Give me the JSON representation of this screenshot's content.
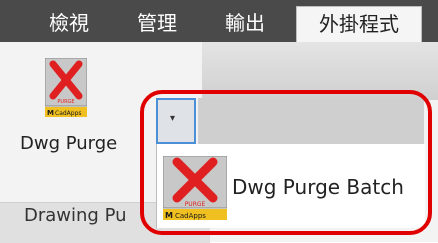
{
  "tabs": [
    {
      "label": "檢視"
    },
    {
      "label": "管理"
    },
    {
      "label": "輸出"
    },
    {
      "label": "外掛程式"
    }
  ],
  "ribbon": {
    "app_button_label": "Dwg Purge",
    "panel_title": "Drawing Pu"
  },
  "icon": {
    "name": "purge-x-icon",
    "purge_text": "PURGE",
    "brand_text": "CadApps",
    "brand_prefix": "M",
    "color": "#e02020"
  },
  "dropdown": {
    "arrow_glyph": "▾",
    "items": [
      {
        "label": "Dwg Purge Batch"
      }
    ]
  },
  "colors": {
    "tab_bar": "#4a4a4a",
    "active_tab": "#f5f5f5",
    "highlight_border": "#4b8fd6",
    "annotation": "#e00000"
  }
}
